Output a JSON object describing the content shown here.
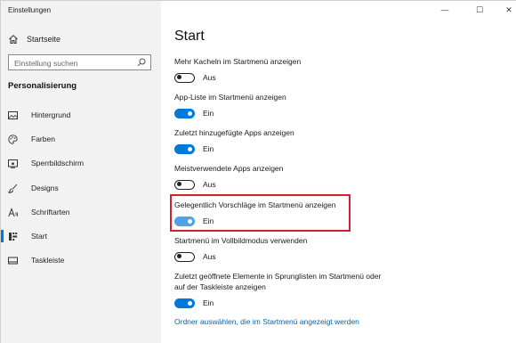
{
  "window": {
    "title": "Einstellungen",
    "controls": [
      "—",
      "☐",
      "✕"
    ]
  },
  "sidebar": {
    "home_label": "Startseite",
    "search_placeholder": "Einstellung suchen",
    "section_title": "Personalisierung",
    "items": [
      {
        "label": "Hintergrund",
        "icon": "picture-icon",
        "active": false
      },
      {
        "label": "Farben",
        "icon": "palette-icon",
        "active": false
      },
      {
        "label": "Sperrbildschirm",
        "icon": "lock-screen-icon",
        "active": false
      },
      {
        "label": "Designs",
        "icon": "brush-icon",
        "active": false
      },
      {
        "label": "Schriftarten",
        "icon": "font-icon",
        "active": false
      },
      {
        "label": "Start",
        "icon": "start-icon",
        "active": true
      },
      {
        "label": "Taskleiste",
        "icon": "taskbar-icon",
        "active": false
      }
    ]
  },
  "main": {
    "title": "Start",
    "settings": [
      {
        "label": "Mehr Kacheln im Startmenü anzeigen",
        "on": false,
        "state": "Aus"
      },
      {
        "label": "App-Liste im Startmenü anzeigen",
        "on": true,
        "state": "Ein"
      },
      {
        "label": "Zuletzt hinzugefügte Apps anzeigen",
        "on": true,
        "state": "Ein"
      },
      {
        "label": "Meistverwendete Apps anzeigen",
        "on": false,
        "state": "Aus"
      },
      {
        "label": "Gelegentlich Vorschläge im Startmenü anzeigen",
        "on": true,
        "state": "Ein",
        "highlighted": true
      },
      {
        "label": "Startmenü im Vollbildmodus verwenden",
        "on": false,
        "state": "Aus"
      },
      {
        "label": "Zuletzt geöffnete Elemente in Sprunglisten im Startmenü oder auf der Taskleiste anzeigen",
        "on": true,
        "state": "Ein"
      }
    ],
    "link": "Ordner auswählen, die im Startmenü angezeigt werden"
  },
  "colors": {
    "accent": "#0078d7",
    "highlight_border": "#d7202b",
    "link": "#0066b4",
    "sidebar_bg": "#f2f2f2"
  }
}
